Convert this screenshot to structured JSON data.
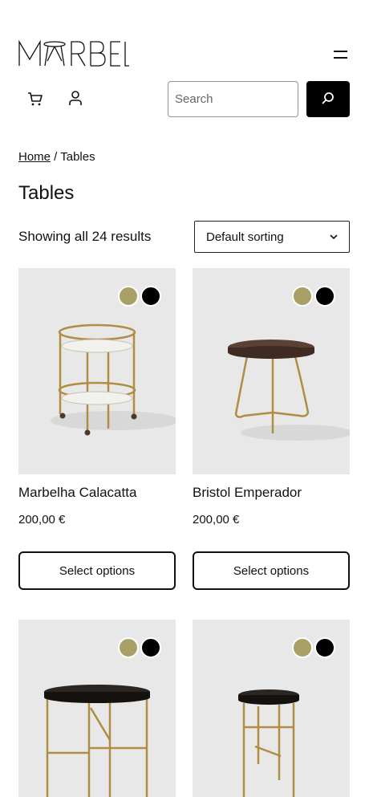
{
  "header": {
    "logo_text": "MARBEL",
    "search": {
      "placeholder": "Search",
      "value": ""
    }
  },
  "breadcrumb": {
    "home": "Home",
    "separator": " / ",
    "current": "Tables"
  },
  "page_title": "Tables",
  "results": {
    "count_text": "Showing all 24 results",
    "sort_selected": "Default sorting"
  },
  "colors": {
    "gold_swatch": "#a9a067",
    "black_swatch": "#000000",
    "image_bg": "#e8e8e8",
    "brass": "#b08d45"
  },
  "products": [
    {
      "name": "Marbelha Calacatta",
      "price": "200,00 €",
      "button": "Select options"
    },
    {
      "name": "Bristol Emperador",
      "price": "200,00 €",
      "button": "Select options"
    },
    {
      "name": "",
      "price": "",
      "button": ""
    },
    {
      "name": "",
      "price": "",
      "button": ""
    }
  ]
}
